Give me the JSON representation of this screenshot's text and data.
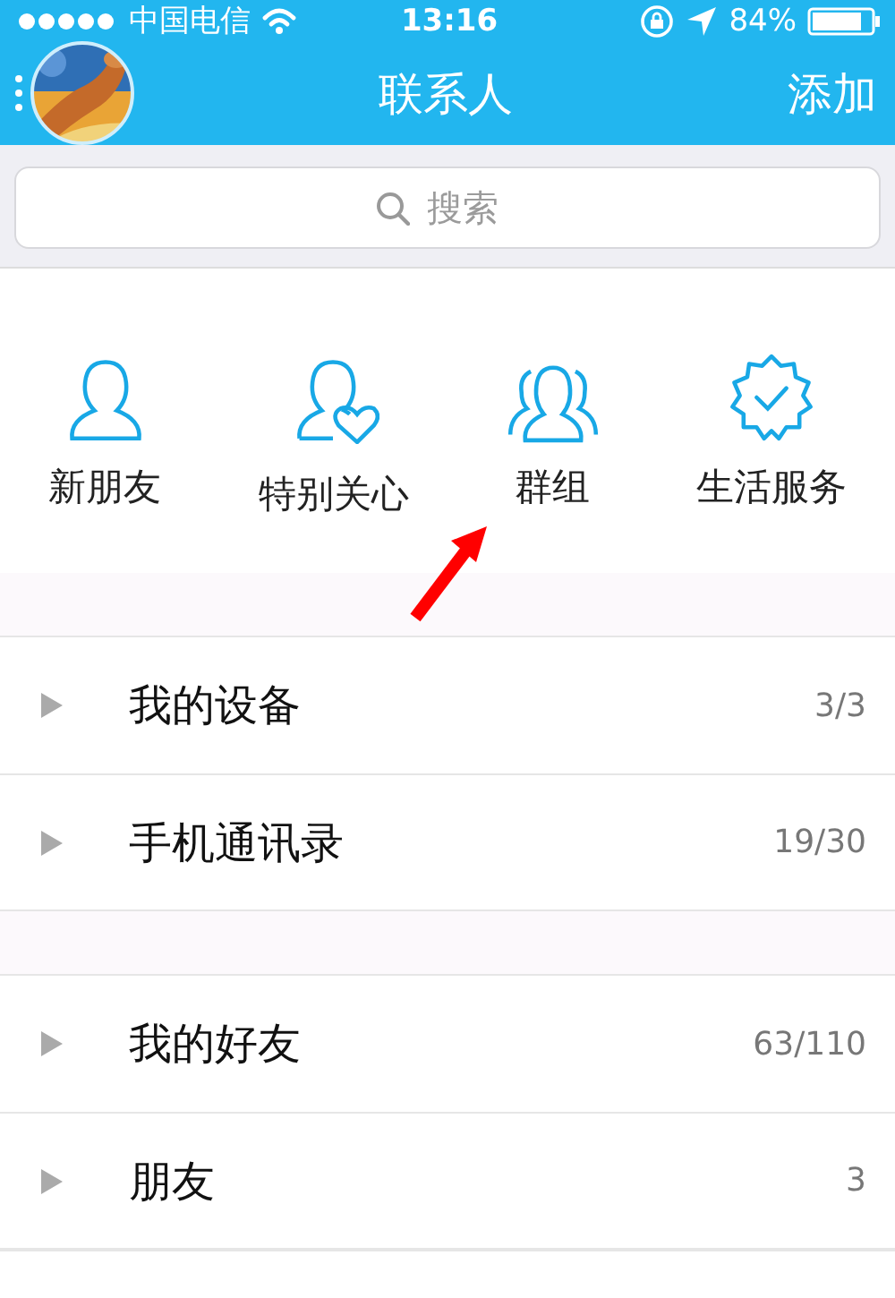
{
  "status_bar": {
    "carrier": "中国电信",
    "time": "13:16",
    "battery": "84%"
  },
  "nav": {
    "title": "联系人",
    "action": "添加"
  },
  "search": {
    "placeholder": "搜索"
  },
  "shortcuts": [
    {
      "kind": "person",
      "label": "新朋友"
    },
    {
      "kind": "heart",
      "label": "特别关心"
    },
    {
      "kind": "group",
      "label": "群组"
    },
    {
      "kind": "badge",
      "label": "生活服务"
    }
  ],
  "sections": [
    {
      "groups": [
        {
          "name": "我的设备",
          "count": "3/3",
          "expanded": false
        },
        {
          "name": "手机通讯录",
          "count": "19/30",
          "expanded": false
        }
      ]
    },
    {
      "groups": [
        {
          "name": "我的好友",
          "count": "63/110",
          "expanded": false
        },
        {
          "name": "朋友",
          "count": "3",
          "expanded": false
        }
      ]
    }
  ]
}
